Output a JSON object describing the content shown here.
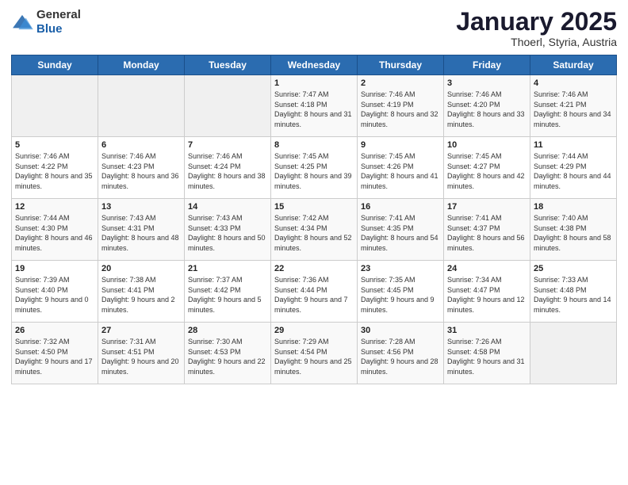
{
  "header": {
    "logo_general": "General",
    "logo_blue": "Blue",
    "title": "January 2025",
    "subtitle": "Thoerl, Styria, Austria"
  },
  "days_of_week": [
    "Sunday",
    "Monday",
    "Tuesday",
    "Wednesday",
    "Thursday",
    "Friday",
    "Saturday"
  ],
  "weeks": [
    [
      {
        "day": "",
        "info": ""
      },
      {
        "day": "",
        "info": ""
      },
      {
        "day": "",
        "info": ""
      },
      {
        "day": "1",
        "info": "Sunrise: 7:47 AM\nSunset: 4:18 PM\nDaylight: 8 hours and 31 minutes."
      },
      {
        "day": "2",
        "info": "Sunrise: 7:46 AM\nSunset: 4:19 PM\nDaylight: 8 hours and 32 minutes."
      },
      {
        "day": "3",
        "info": "Sunrise: 7:46 AM\nSunset: 4:20 PM\nDaylight: 8 hours and 33 minutes."
      },
      {
        "day": "4",
        "info": "Sunrise: 7:46 AM\nSunset: 4:21 PM\nDaylight: 8 hours and 34 minutes."
      }
    ],
    [
      {
        "day": "5",
        "info": "Sunrise: 7:46 AM\nSunset: 4:22 PM\nDaylight: 8 hours and 35 minutes."
      },
      {
        "day": "6",
        "info": "Sunrise: 7:46 AM\nSunset: 4:23 PM\nDaylight: 8 hours and 36 minutes."
      },
      {
        "day": "7",
        "info": "Sunrise: 7:46 AM\nSunset: 4:24 PM\nDaylight: 8 hours and 38 minutes."
      },
      {
        "day": "8",
        "info": "Sunrise: 7:45 AM\nSunset: 4:25 PM\nDaylight: 8 hours and 39 minutes."
      },
      {
        "day": "9",
        "info": "Sunrise: 7:45 AM\nSunset: 4:26 PM\nDaylight: 8 hours and 41 minutes."
      },
      {
        "day": "10",
        "info": "Sunrise: 7:45 AM\nSunset: 4:27 PM\nDaylight: 8 hours and 42 minutes."
      },
      {
        "day": "11",
        "info": "Sunrise: 7:44 AM\nSunset: 4:29 PM\nDaylight: 8 hours and 44 minutes."
      }
    ],
    [
      {
        "day": "12",
        "info": "Sunrise: 7:44 AM\nSunset: 4:30 PM\nDaylight: 8 hours and 46 minutes."
      },
      {
        "day": "13",
        "info": "Sunrise: 7:43 AM\nSunset: 4:31 PM\nDaylight: 8 hours and 48 minutes."
      },
      {
        "day": "14",
        "info": "Sunrise: 7:43 AM\nSunset: 4:33 PM\nDaylight: 8 hours and 50 minutes."
      },
      {
        "day": "15",
        "info": "Sunrise: 7:42 AM\nSunset: 4:34 PM\nDaylight: 8 hours and 52 minutes."
      },
      {
        "day": "16",
        "info": "Sunrise: 7:41 AM\nSunset: 4:35 PM\nDaylight: 8 hours and 54 minutes."
      },
      {
        "day": "17",
        "info": "Sunrise: 7:41 AM\nSunset: 4:37 PM\nDaylight: 8 hours and 56 minutes."
      },
      {
        "day": "18",
        "info": "Sunrise: 7:40 AM\nSunset: 4:38 PM\nDaylight: 8 hours and 58 minutes."
      }
    ],
    [
      {
        "day": "19",
        "info": "Sunrise: 7:39 AM\nSunset: 4:40 PM\nDaylight: 9 hours and 0 minutes."
      },
      {
        "day": "20",
        "info": "Sunrise: 7:38 AM\nSunset: 4:41 PM\nDaylight: 9 hours and 2 minutes."
      },
      {
        "day": "21",
        "info": "Sunrise: 7:37 AM\nSunset: 4:42 PM\nDaylight: 9 hours and 5 minutes."
      },
      {
        "day": "22",
        "info": "Sunrise: 7:36 AM\nSunset: 4:44 PM\nDaylight: 9 hours and 7 minutes."
      },
      {
        "day": "23",
        "info": "Sunrise: 7:35 AM\nSunset: 4:45 PM\nDaylight: 9 hours and 9 minutes."
      },
      {
        "day": "24",
        "info": "Sunrise: 7:34 AM\nSunset: 4:47 PM\nDaylight: 9 hours and 12 minutes."
      },
      {
        "day": "25",
        "info": "Sunrise: 7:33 AM\nSunset: 4:48 PM\nDaylight: 9 hours and 14 minutes."
      }
    ],
    [
      {
        "day": "26",
        "info": "Sunrise: 7:32 AM\nSunset: 4:50 PM\nDaylight: 9 hours and 17 minutes."
      },
      {
        "day": "27",
        "info": "Sunrise: 7:31 AM\nSunset: 4:51 PM\nDaylight: 9 hours and 20 minutes."
      },
      {
        "day": "28",
        "info": "Sunrise: 7:30 AM\nSunset: 4:53 PM\nDaylight: 9 hours and 22 minutes."
      },
      {
        "day": "29",
        "info": "Sunrise: 7:29 AM\nSunset: 4:54 PM\nDaylight: 9 hours and 25 minutes."
      },
      {
        "day": "30",
        "info": "Sunrise: 7:28 AM\nSunset: 4:56 PM\nDaylight: 9 hours and 28 minutes."
      },
      {
        "day": "31",
        "info": "Sunrise: 7:26 AM\nSunset: 4:58 PM\nDaylight: 9 hours and 31 minutes."
      },
      {
        "day": "",
        "info": ""
      }
    ]
  ]
}
